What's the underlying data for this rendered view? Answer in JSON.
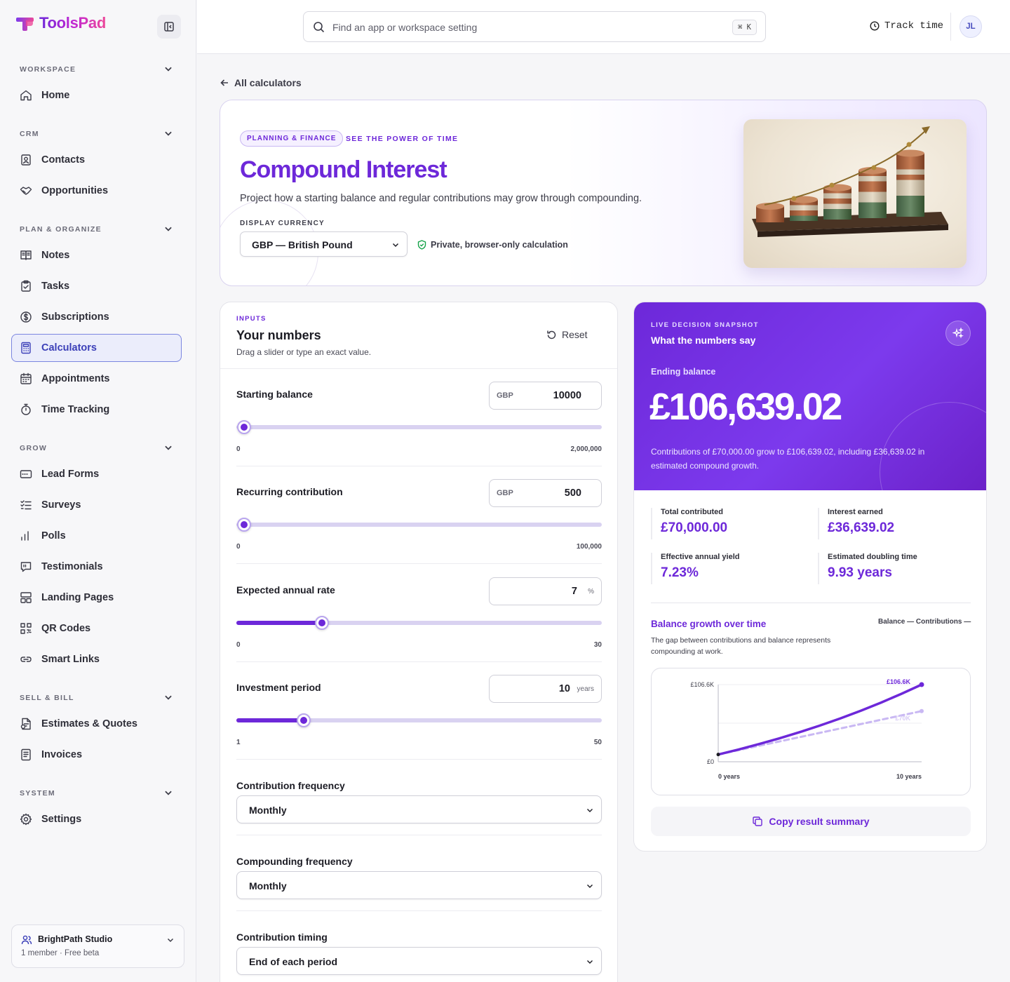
{
  "brand": {
    "name": "ToolsPad"
  },
  "sidebar": {
    "sections": [
      {
        "title": "WORKSPACE",
        "items": [
          {
            "label": "Home",
            "icon": "home-icon"
          }
        ]
      },
      {
        "title": "CRM",
        "items": [
          {
            "label": "Contacts",
            "icon": "contacts-icon"
          },
          {
            "label": "Opportunities",
            "icon": "handshake-icon"
          }
        ]
      },
      {
        "title": "PLAN & ORGANIZE",
        "items": [
          {
            "label": "Notes",
            "icon": "notes-icon"
          },
          {
            "label": "Tasks",
            "icon": "clipboard-check-icon"
          },
          {
            "label": "Subscriptions",
            "icon": "dollar-circle-icon"
          },
          {
            "label": "Calculators",
            "icon": "calculator-icon",
            "active": true
          },
          {
            "label": "Appointments",
            "icon": "calendar-icon"
          },
          {
            "label": "Time Tracking",
            "icon": "stopwatch-icon"
          }
        ]
      },
      {
        "title": "GROW",
        "items": [
          {
            "label": "Lead Forms",
            "icon": "form-icon"
          },
          {
            "label": "Surveys",
            "icon": "checklist-icon"
          },
          {
            "label": "Polls",
            "icon": "bar-chart-icon"
          },
          {
            "label": "Testimonials",
            "icon": "quote-icon"
          },
          {
            "label": "Landing Pages",
            "icon": "layout-icon"
          },
          {
            "label": "QR Codes",
            "icon": "qr-icon"
          },
          {
            "label": "Smart Links",
            "icon": "link-icon"
          }
        ]
      },
      {
        "title": "SELL & BILL",
        "items": [
          {
            "label": "Estimates & Quotes",
            "icon": "document-icon"
          },
          {
            "label": "Invoices",
            "icon": "invoice-icon"
          }
        ]
      },
      {
        "title": "SYSTEM",
        "items": [
          {
            "label": "Settings",
            "icon": "gear-icon"
          }
        ]
      }
    ],
    "workspace": {
      "name": "BrightPath Studio",
      "meta": "1 member · Free beta"
    }
  },
  "topbar": {
    "search_placeholder": "Find an app or workspace setting",
    "shortcut": "⌘ K",
    "track_label": "Track time",
    "avatar_initials": "JL"
  },
  "main": {
    "back_label": "All calculators",
    "hero": {
      "pill": "PLANNING & FINANCE",
      "eyebrow": "SEE THE POWER OF TIME",
      "title": "Compound Interest",
      "description": "Project how a starting balance and regular contributions may grow through compounding.",
      "currency_label": "DISPLAY CURRENCY",
      "currency_value": "GBP — British Pound",
      "privacy_note": "Private, browser-only calculation"
    },
    "inputs": {
      "eyebrow": "INPUTS",
      "title": "Your numbers",
      "subtitle": "Drag a slider or type an exact value.",
      "reset_label": "Reset",
      "fields": [
        {
          "label": "Starting balance",
          "prefix": "GBP",
          "value": "10000",
          "suffix": "",
          "min": "0",
          "max": "2,000,000",
          "fraction": 0.005
        },
        {
          "label": "Recurring contribution",
          "prefix": "GBP",
          "value": "500",
          "suffix": "",
          "min": "0",
          "max": "100,000",
          "fraction": 0.005
        },
        {
          "label": "Expected annual rate",
          "prefix": "",
          "value": "7",
          "suffix": "%",
          "min": "0",
          "max": "30",
          "fraction": 0.2333
        },
        {
          "label": "Investment period",
          "prefix": "",
          "value": "10",
          "suffix": "years",
          "min": "1",
          "max": "50",
          "fraction": 0.1837
        }
      ],
      "selects": [
        {
          "label": "Contribution frequency",
          "value": "Monthly"
        },
        {
          "label": "Compounding frequency",
          "value": "Monthly"
        },
        {
          "label": "Contribution timing",
          "value": "End of each period"
        }
      ]
    },
    "results": {
      "eyebrow": "LIVE DECISION SNAPSHOT",
      "title": "What the numbers say",
      "ending_label": "Ending balance",
      "ending_value": "£106,639.02",
      "summary": "Contributions of £70,000.00 grow to £106,639.02, including £36,639.02 in estimated compound growth.",
      "stats": [
        {
          "label": "Total contributed",
          "value": "£70,000.00"
        },
        {
          "label": "Interest earned",
          "value": "£36,639.02"
        },
        {
          "label": "Effective annual yield",
          "value": "7.23%"
        },
        {
          "label": "Estimated doubling time",
          "value": "9.93 years"
        }
      ],
      "chart_title": "Balance growth over time",
      "legend": "Balance — Contributions —",
      "chart_description": "The gap between contributions and balance represents compounding at work.",
      "copy_label": "Copy result summary"
    }
  },
  "chart_data": {
    "type": "line",
    "x": [
      0,
      1,
      2,
      3,
      4,
      5,
      6,
      7,
      8,
      9,
      10
    ],
    "series": [
      {
        "name": "Balance",
        "values": [
          10000,
          16931,
          24363,
          32332,
          40878,
          50041,
          59867,
          70403,
          81701,
          93815,
          106639
        ],
        "color": "#6d28d9"
      },
      {
        "name": "Contributions",
        "values": [
          10000,
          16000,
          22000,
          28000,
          34000,
          40000,
          46000,
          52000,
          58000,
          64000,
          70000
        ],
        "color": "#c9b8f3"
      }
    ],
    "y_tick_labels": [
      "£0",
      "£106.6K"
    ],
    "x_tick_labels": [
      "0 years",
      "10 years"
    ],
    "end_labels": [
      "£106.6K",
      "£70K"
    ],
    "ylim": [
      0,
      106639
    ],
    "xlim": [
      0,
      10
    ],
    "grid": true
  }
}
